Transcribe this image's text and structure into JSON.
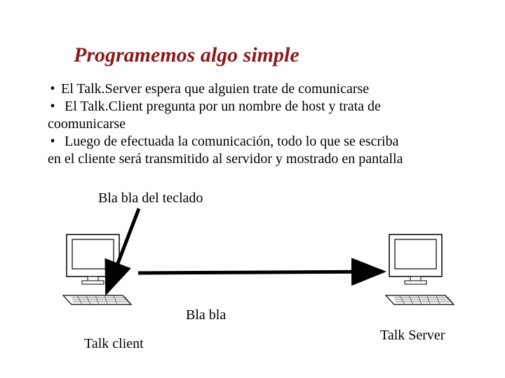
{
  "title": "Programemos algo simple",
  "bullets": {
    "b1": "El Talk.Server espera que alguien trate de comunicarse",
    "b2_line1": "El Talk.Client pregunta por un nombre de host y trata de",
    "b2_line2": "coomunicarse",
    "b3_line1": "Luego de efectuada la comunicación, todo lo que se escriba",
    "b3_line2": "en el cliente será transmitido al servidor y mostrado en pantalla"
  },
  "labels": {
    "keyboard_input": "Bla bla del teclado",
    "transmission": "Bla bla",
    "client": "Talk client",
    "server": "Talk Server"
  }
}
